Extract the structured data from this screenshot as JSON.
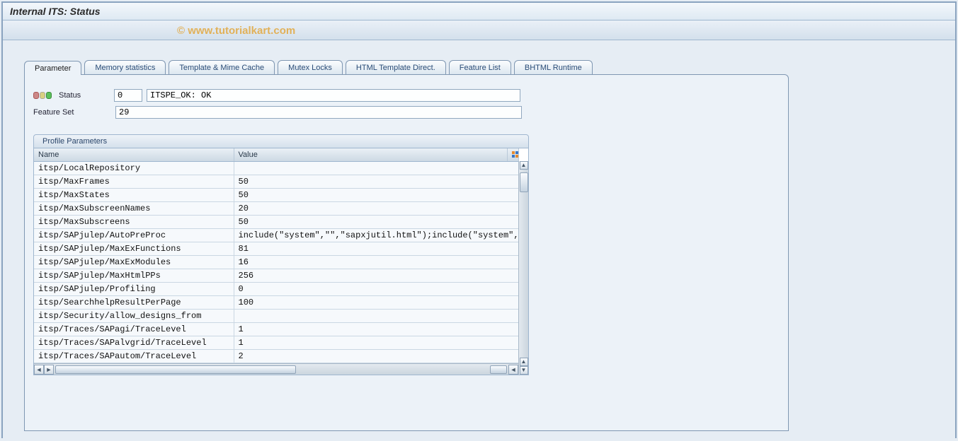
{
  "page_title": "Internal ITS: Status",
  "watermark": "© www.tutorialkart.com",
  "tabs": [
    {
      "label": "Parameter"
    },
    {
      "label": "Memory statistics"
    },
    {
      "label": "Template & Mime Cache"
    },
    {
      "label": "Mutex Locks"
    },
    {
      "label": "HTML Template Direct."
    },
    {
      "label": "Feature List"
    },
    {
      "label": "BHTML Runtime"
    }
  ],
  "status_row": {
    "label": "Status",
    "code": "0",
    "text": "ITSPE_OK: OK"
  },
  "feature_set_row": {
    "label": "Feature Set",
    "value": "29"
  },
  "group": {
    "title": "Profile Parameters",
    "columns": {
      "name": "Name",
      "value": "Value"
    },
    "rows": [
      {
        "name": "itsp/LocalRepository",
        "value": ""
      },
      {
        "name": "itsp/MaxFrames",
        "value": "50"
      },
      {
        "name": "itsp/MaxStates",
        "value": "50"
      },
      {
        "name": "itsp/MaxSubscreenNames",
        "value": "20"
      },
      {
        "name": "itsp/MaxSubscreens",
        "value": "50"
      },
      {
        "name": "itsp/SAPjulep/AutoPreProc",
        "value": "include(\"system\",\"\",\"sapxjutil.html\");include(\"system\",\"\","
      },
      {
        "name": "itsp/SAPjulep/MaxExFunctions",
        "value": "81"
      },
      {
        "name": "itsp/SAPjulep/MaxExModules",
        "value": "16"
      },
      {
        "name": "itsp/SAPjulep/MaxHtmlPPs",
        "value": "256"
      },
      {
        "name": "itsp/SAPjulep/Profiling",
        "value": "0"
      },
      {
        "name": "itsp/SearchhelpResultPerPage",
        "value": "100"
      },
      {
        "name": "itsp/Security/allow_designs_from",
        "value": ""
      },
      {
        "name": "itsp/Traces/SAPagi/TraceLevel",
        "value": "1"
      },
      {
        "name": "itsp/Traces/SAPalvgrid/TraceLevel",
        "value": "1"
      },
      {
        "name": "itsp/Traces/SAPautom/TraceLevel",
        "value": "2"
      }
    ]
  }
}
